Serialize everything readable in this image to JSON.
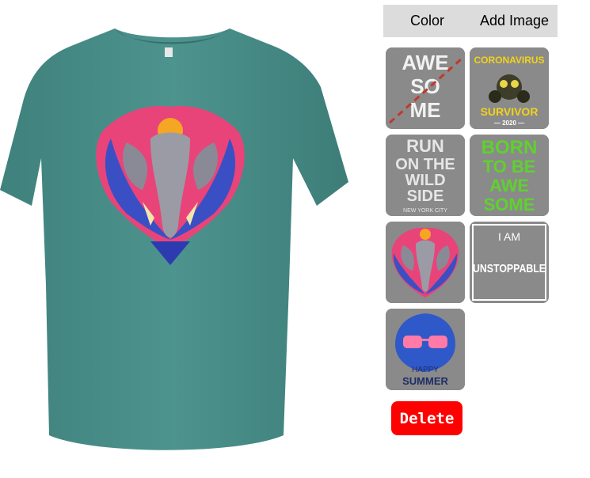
{
  "tabs": {
    "color_label": "Color",
    "add_image_label": "Add Image"
  },
  "shirt": {
    "color": "#4a8f8a",
    "design": "elephant-heart-design"
  },
  "gallery": [
    {
      "name": "awesome-design",
      "lines": [
        "AWE",
        "SO",
        "ME"
      ]
    },
    {
      "name": "coronavirus-survivor-design",
      "top": "CORONAVIRUS",
      "bottom": "SURVIVOR",
      "year": "— 2020 —"
    },
    {
      "name": "run-on-the-wild-side-design",
      "lines": [
        "RUN",
        "ON THE",
        "WILD",
        "SIDE"
      ],
      "sub": "NEW YORK CITY"
    },
    {
      "name": "born-to-be-awesome-design",
      "lines": [
        "BORN",
        "TO BE",
        "AWE",
        "SOME"
      ]
    },
    {
      "name": "elephant-design",
      "label": ""
    },
    {
      "name": "i-am-unstoppable-design",
      "top": "I AM",
      "main": "UNSTOPPABLE"
    },
    {
      "name": "happy-summer-tiger-design",
      "top": "HAPPY",
      "bottom": "SUMMER"
    }
  ],
  "actions": {
    "delete_label": "Delete"
  },
  "colors": {
    "accent_red": "#ff0000",
    "tab_bar": "#dcdcdc",
    "thumb_bg": "#8a8a8a"
  }
}
